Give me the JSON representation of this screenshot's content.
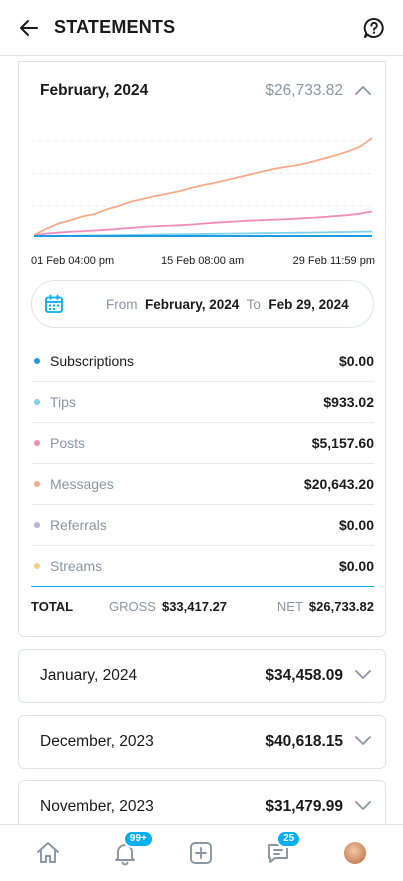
{
  "header": {
    "title": "STATEMENTS"
  },
  "current_statement": {
    "month": "February, 2024",
    "net_amount": "$26,733.82",
    "x_labels": [
      "01 Feb 04:00 pm",
      "15 Feb 08:00 am",
      "29 Feb 11:59 pm"
    ],
    "range": {
      "from_label": "From",
      "from_value": "February, 2024",
      "to_label": "To",
      "to_value": "Feb 29, 2024"
    },
    "categories": [
      {
        "name": "Subscriptions",
        "value": "$0.00",
        "color": "#1e9be0"
      },
      {
        "name": "Tips",
        "value": "$933.02",
        "color": "#7fd3e8"
      },
      {
        "name": "Posts",
        "value": "$5,157.60",
        "color": "#f08cb8"
      },
      {
        "name": "Messages",
        "value": "$20,643.20",
        "color": "#f7a98a"
      },
      {
        "name": "Referrals",
        "value": "$0.00",
        "color": "#b9b3dc"
      },
      {
        "name": "Streams",
        "value": "$0.00",
        "color": "#f7cf8a"
      }
    ],
    "totals": {
      "total_label": "TOTAL",
      "gross_label": "GROSS",
      "gross_value": "$33,417.27",
      "net_label": "NET",
      "net_value": "$26,733.82"
    }
  },
  "chart_data": {
    "type": "line",
    "x": [
      0,
      1,
      2,
      3,
      4,
      5,
      6,
      7,
      8,
      9,
      10,
      11,
      12,
      13,
      14,
      15,
      16,
      17,
      18,
      19,
      20,
      21,
      22,
      23,
      24,
      25,
      26,
      27,
      28
    ],
    "x_tick_labels": [
      "01 Feb 04:00 pm",
      "15 Feb 08:00 am",
      "29 Feb 11:59 pm"
    ],
    "ylim": [
      0,
      24000
    ],
    "grid": true,
    "series": [
      {
        "color": "#f7a98a",
        "values": [
          200,
          1500,
          2600,
          3300,
          4100,
          4600,
          5600,
          6300,
          7200,
          7800,
          8400,
          8900,
          9400,
          10100,
          10700,
          11200,
          11800,
          12400,
          13000,
          13600,
          14200,
          14600,
          15000,
          15600,
          16300,
          17000,
          17800,
          18800,
          20643
        ]
      },
      {
        "color": "#f08cb8",
        "values": [
          100,
          500,
          700,
          900,
          1000,
          1150,
          1300,
          1500,
          1700,
          1900,
          2050,
          2150,
          2250,
          2400,
          2600,
          2800,
          2950,
          3100,
          3250,
          3350,
          3450,
          3550,
          3700,
          3850,
          4000,
          4200,
          4400,
          4700,
          5157
        ]
      },
      {
        "color": "#7fd3e8",
        "values": [
          0,
          20,
          40,
          60,
          90,
          120,
          150,
          180,
          220,
          260,
          300,
          330,
          360,
          400,
          430,
          460,
          500,
          530,
          560,
          600,
          630,
          660,
          700,
          730,
          770,
          810,
          850,
          890,
          933
        ]
      },
      {
        "color": "#1e9be0",
        "values": [
          0,
          0,
          0,
          0,
          0,
          0,
          0,
          0,
          0,
          0,
          0,
          0,
          0,
          0,
          0,
          0,
          0,
          0,
          0,
          0,
          0,
          0,
          0,
          0,
          0,
          0,
          0,
          0,
          0
        ]
      }
    ]
  },
  "other_statements": [
    {
      "month": "January, 2024",
      "amount": "$34,458.09"
    },
    {
      "month": "December, 2023",
      "amount": "$40,618.15"
    },
    {
      "month": "November, 2023",
      "amount": "$31,479.99"
    }
  ],
  "nav": {
    "notifications_badge": "99+",
    "messages_badge": "25"
  },
  "icons": [
    "back-arrow-icon",
    "help-icon",
    "chevron-up-icon",
    "calendar-icon",
    "chevron-down-icon",
    "home-icon",
    "bell-icon",
    "plus-square-icon",
    "message-icon",
    "avatar"
  ],
  "colors": {
    "accent": "#00aff0",
    "muted": "#8a96a3",
    "text": "#1a1a1a"
  }
}
